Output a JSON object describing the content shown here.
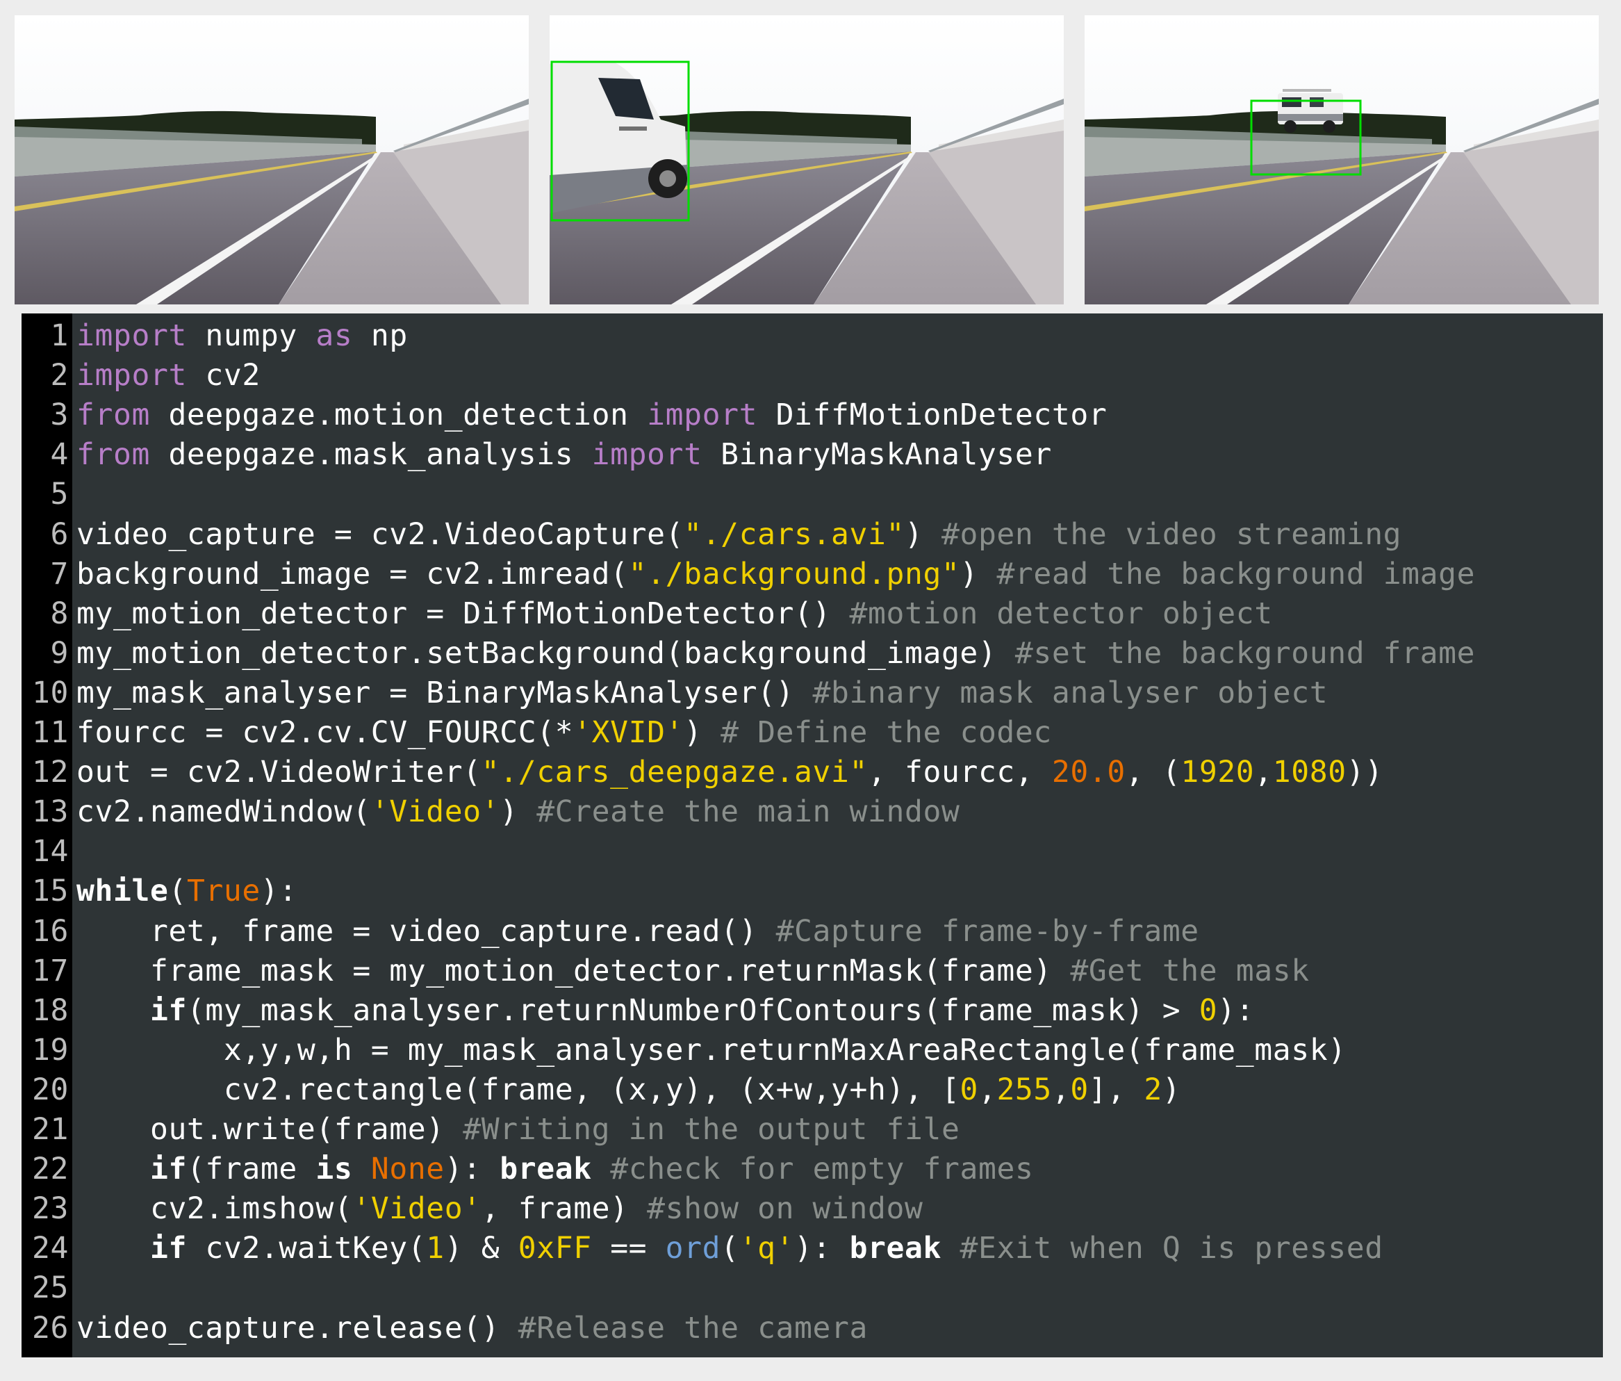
{
  "frames": [
    {
      "name": "frame-empty-road",
      "has_detection": false
    },
    {
      "name": "frame-van-close",
      "has_detection": true
    },
    {
      "name": "frame-van-distant",
      "has_detection": true
    }
  ],
  "colors": {
    "editor_background": "#2e3436",
    "gutter_background": "#000000",
    "keyword": "#b77ec8",
    "string": "#f0d000",
    "constant": "#e86f00",
    "builtin": "#6f9fd8",
    "comment": "#8a8f8c",
    "detection_box": "#00dd00"
  },
  "code_lines": [
    {
      "n": "1",
      "tokens": [
        [
          "kw",
          "import"
        ],
        [
          "tx",
          " numpy "
        ],
        [
          "kw",
          "as"
        ],
        [
          "tx",
          " np"
        ]
      ]
    },
    {
      "n": "2",
      "tokens": [
        [
          "kw",
          "import"
        ],
        [
          "tx",
          " cv2"
        ]
      ]
    },
    {
      "n": "3",
      "tokens": [
        [
          "kw",
          "from"
        ],
        [
          "tx",
          " deepgaze.motion_detection "
        ],
        [
          "kw",
          "import"
        ],
        [
          "tx",
          " DiffMotionDetector"
        ]
      ]
    },
    {
      "n": "4",
      "tokens": [
        [
          "kw",
          "from"
        ],
        [
          "tx",
          " deepgaze.mask_analysis "
        ],
        [
          "kw",
          "import"
        ],
        [
          "tx",
          " BinaryMaskAnalyser"
        ]
      ]
    },
    {
      "n": "5",
      "tokens": []
    },
    {
      "n": "6",
      "tokens": [
        [
          "tx",
          "video_capture = cv2.VideoCapture("
        ],
        [
          "str",
          "\"./cars.avi\""
        ],
        [
          "tx",
          ") "
        ],
        [
          "cm",
          "#open the video streaming"
        ]
      ]
    },
    {
      "n": "7",
      "tokens": [
        [
          "tx",
          "background_image = cv2.imread("
        ],
        [
          "str",
          "\"./background.png\""
        ],
        [
          "tx",
          ") "
        ],
        [
          "cm",
          "#read the background image"
        ]
      ]
    },
    {
      "n": "8",
      "tokens": [
        [
          "tx",
          "my_motion_detector = DiffMotionDetector() "
        ],
        [
          "cm",
          "#motion detector object"
        ]
      ]
    },
    {
      "n": "9",
      "tokens": [
        [
          "tx",
          "my_motion_detector.setBackground(background_image) "
        ],
        [
          "cm",
          "#set the background frame"
        ]
      ]
    },
    {
      "n": "10",
      "tokens": [
        [
          "tx",
          "my_mask_analyser = BinaryMaskAnalyser() "
        ],
        [
          "cm",
          "#binary mask analyser object"
        ]
      ]
    },
    {
      "n": "11",
      "tokens": [
        [
          "tx",
          "fourcc = cv2.cv.CV_FOURCC(*"
        ],
        [
          "str",
          "'XVID'"
        ],
        [
          "tx",
          ") "
        ],
        [
          "cm",
          "# Define the codec"
        ]
      ]
    },
    {
      "n": "12",
      "tokens": [
        [
          "tx",
          "out = cv2.VideoWriter("
        ],
        [
          "str",
          "\"./cars_deepgaze.avi\""
        ],
        [
          "tx",
          ", fourcc, "
        ],
        [
          "flt",
          "20.0"
        ],
        [
          "tx",
          ", ("
        ],
        [
          "num",
          "1920"
        ],
        [
          "tx",
          ","
        ],
        [
          "num",
          "1080"
        ],
        [
          "tx",
          "))"
        ]
      ]
    },
    {
      "n": "13",
      "tokens": [
        [
          "tx",
          "cv2.namedWindow("
        ],
        [
          "str",
          "'Video'"
        ],
        [
          "tx",
          ") "
        ],
        [
          "cm",
          "#Create the main window"
        ]
      ]
    },
    {
      "n": "14",
      "tokens": []
    },
    {
      "n": "15",
      "tokens": [
        [
          "bk",
          "while"
        ],
        [
          "tx",
          "("
        ],
        [
          "cn",
          "True"
        ],
        [
          "tx",
          "):"
        ]
      ]
    },
    {
      "n": "16",
      "tokens": [
        [
          "tx",
          "    ret, frame = video_capture.read() "
        ],
        [
          "cm",
          "#Capture frame-by-frame"
        ]
      ]
    },
    {
      "n": "17",
      "tokens": [
        [
          "tx",
          "    frame_mask = my_motion_detector.returnMask(frame) "
        ],
        [
          "cm",
          "#Get the mask"
        ]
      ]
    },
    {
      "n": "18",
      "tokens": [
        [
          "tx",
          "    "
        ],
        [
          "bk",
          "if"
        ],
        [
          "tx",
          "(my_mask_analyser.returnNumberOfContours(frame_mask) > "
        ],
        [
          "num",
          "0"
        ],
        [
          "tx",
          "):"
        ]
      ]
    },
    {
      "n": "19",
      "tokens": [
        [
          "tx",
          "        x,y,w,h = my_mask_analyser.returnMaxAreaRectangle(frame_mask)"
        ]
      ]
    },
    {
      "n": "20",
      "tokens": [
        [
          "tx",
          "        cv2.rectangle(frame, (x,y), (x+w,y+h), ["
        ],
        [
          "num",
          "0"
        ],
        [
          "tx",
          ","
        ],
        [
          "num",
          "255"
        ],
        [
          "tx",
          ","
        ],
        [
          "num",
          "0"
        ],
        [
          "tx",
          "], "
        ],
        [
          "num",
          "2"
        ],
        [
          "tx",
          ")"
        ]
      ]
    },
    {
      "n": "21",
      "tokens": [
        [
          "tx",
          "    out.write(frame) "
        ],
        [
          "cm",
          "#Writing in the output file"
        ]
      ]
    },
    {
      "n": "22",
      "tokens": [
        [
          "tx",
          "    "
        ],
        [
          "bk",
          "if"
        ],
        [
          "tx",
          "(frame "
        ],
        [
          "bk",
          "is"
        ],
        [
          "tx",
          " "
        ],
        [
          "cn",
          "None"
        ],
        [
          "tx",
          "): "
        ],
        [
          "bk",
          "break"
        ],
        [
          "tx",
          " "
        ],
        [
          "cm",
          "#check for empty frames"
        ]
      ]
    },
    {
      "n": "23",
      "tokens": [
        [
          "tx",
          "    cv2.imshow("
        ],
        [
          "str",
          "'Video'"
        ],
        [
          "tx",
          ", frame) "
        ],
        [
          "cm",
          "#show on window"
        ]
      ]
    },
    {
      "n": "24",
      "tokens": [
        [
          "tx",
          "    "
        ],
        [
          "bk",
          "if"
        ],
        [
          "tx",
          " cv2.waitKey("
        ],
        [
          "num",
          "1"
        ],
        [
          "tx",
          ") & "
        ],
        [
          "num",
          "0xFF"
        ],
        [
          "tx",
          " == "
        ],
        [
          "bi",
          "ord"
        ],
        [
          "tx",
          "("
        ],
        [
          "str",
          "'q'"
        ],
        [
          "tx",
          "): "
        ],
        [
          "bk",
          "break"
        ],
        [
          "tx",
          " "
        ],
        [
          "cm",
          "#Exit when Q is pressed"
        ]
      ]
    },
    {
      "n": "25",
      "tokens": []
    },
    {
      "n": "26",
      "tokens": [
        [
          "tx",
          "video_capture.release() "
        ],
        [
          "cm",
          "#Release the camera"
        ]
      ]
    }
  ]
}
